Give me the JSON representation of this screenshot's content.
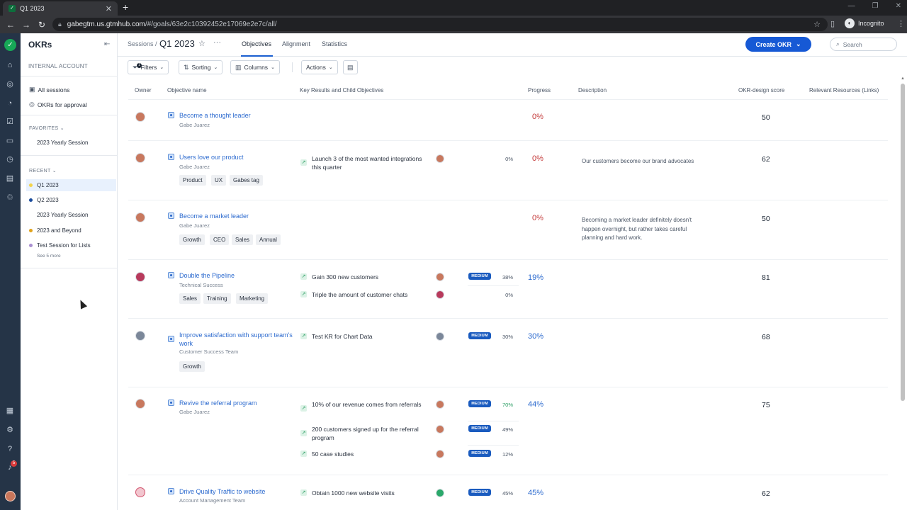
{
  "browser": {
    "tab_title": "Q1 2023",
    "tab_close": "✕",
    "new_tab": "+",
    "url_host": "gabegtm.us.gtmhub.com",
    "url_path": "/#/goals/63e2c10392452e17069e2e7c/all/",
    "incognito_label": "Incognito",
    "window_controls": [
      "—",
      "❐",
      "✕"
    ]
  },
  "sidebar": {
    "title": "OKRs",
    "account": "INTERNAL ACCOUNT",
    "links": [
      {
        "label": "All sessions"
      },
      {
        "label": "OKRs for approval"
      }
    ],
    "favorites_heading": "FAVORITES",
    "favorites": [
      {
        "label": "2023 Yearly Session",
        "color": "#ffffff"
      }
    ],
    "recent_heading": "RECENT",
    "recent": [
      {
        "label": "Q1 2023",
        "color": "#f3d34a"
      },
      {
        "label": "Q2 2023",
        "color": "#1a4b9c"
      },
      {
        "label": "2023 Yearly Session",
        "color": "#ffffff"
      },
      {
        "label": "2023 and Beyond",
        "color": "#e0a21a"
      },
      {
        "label": "Test Session for Lists",
        "color": "#a98fd0"
      }
    ],
    "see_more": "See 5 more"
  },
  "rail": {
    "notification_count": "5"
  },
  "header": {
    "crumb": "Sessions /",
    "title": "Q1 2023",
    "more": "···",
    "tabs": [
      {
        "label": "Objectives"
      },
      {
        "label": "Alignment"
      },
      {
        "label": "Statistics"
      }
    ],
    "create_label": "Create OKR",
    "search_placeholder": "Search"
  },
  "toolbar": {
    "filters": "Filters",
    "filters_count": "1",
    "sorting": "Sorting",
    "columns": "Columns",
    "actions": "Actions"
  },
  "columns": {
    "owner": "Owner",
    "objective": "Objective name",
    "krs": "Key Results and Child Objectives",
    "progress": "Progress",
    "description": "Description",
    "score": "OKR-design score",
    "resources": "Relevant Resources (Links)"
  },
  "objectives": [
    {
      "name": "Become a thought leader",
      "owner": "Gabe Juarez",
      "tags": [],
      "progress": "0%",
      "description": "",
      "score": "50",
      "krs": []
    },
    {
      "name": "Users love our product",
      "owner": "Gabe Juarez",
      "tags": [
        "Product",
        "UX",
        "Gabes tag"
      ],
      "progress": "0%",
      "description": "Our customers become our brand advocates",
      "score": "62",
      "krs": [
        {
          "text": "Launch 3 of the most wanted integrations this quarter",
          "confidence": "",
          "pct": "0%"
        }
      ]
    },
    {
      "name": "Become a market leader",
      "owner": "Gabe Juarez",
      "tags": [
        "Growth",
        "CEO",
        "Sales",
        "Annual"
      ],
      "progress": "0%",
      "description": "Becoming a market leader definitely doesn't happen overnight, but rather takes careful planning and hard work.",
      "score": "50",
      "krs": []
    },
    {
      "name": "Double the Pipeline",
      "owner": "Technical Success",
      "tags": [
        "Sales",
        "Training",
        "Marketing"
      ],
      "progress": "19%",
      "description": "",
      "score": "81",
      "krs": [
        {
          "text": "Gain 300 new customers",
          "confidence": "MEDIUM",
          "pct": "38%"
        },
        {
          "text": "Triple the amount of customer chats",
          "confidence": "",
          "pct": "0%"
        }
      ]
    },
    {
      "name": "Improve satisfaction with support team's work",
      "owner": "Customer Success Team",
      "tags": [
        "Growth"
      ],
      "progress": "30%",
      "description": "",
      "score": "68",
      "krs": [
        {
          "text": "Test KR for Chart Data",
          "confidence": "MEDIUM",
          "pct": "30%"
        }
      ]
    },
    {
      "name": "Revive the referral program",
      "owner": "Gabe Juarez",
      "tags": [],
      "progress": "44%",
      "description": "",
      "score": "75",
      "krs": [
        {
          "text": "10% of our revenue comes from referrals",
          "confidence": "MEDIUM",
          "pct": "70%"
        },
        {
          "text": "200 customers signed up for the referral program",
          "confidence": "MEDIUM",
          "pct": "49%"
        },
        {
          "text": "50 case studies",
          "confidence": "MEDIUM",
          "pct": "12%"
        }
      ]
    },
    {
      "name": "Drive Quality Traffic to website",
      "owner": "Account Management Team",
      "tags": [],
      "progress": "45%",
      "description": "",
      "score": "62",
      "krs": [
        {
          "text": "Obtain 1000 new website visits",
          "confidence": "MEDIUM",
          "pct": "45%"
        }
      ]
    }
  ],
  "colors": {
    "accent": "#1659d5",
    "rail": "#253447",
    "progress_zero": "#c43a3a",
    "progress": "#2d6bcf"
  }
}
